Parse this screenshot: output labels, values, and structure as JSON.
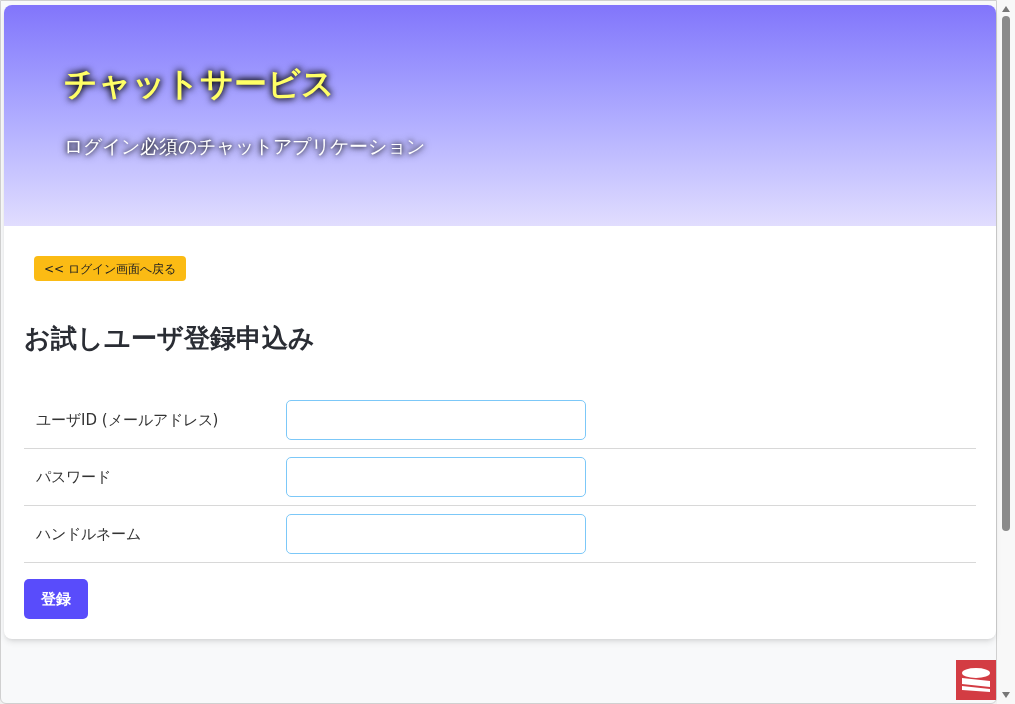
{
  "header": {
    "title": "チャットサービス",
    "subtitle": "ログイン必須のチャットアプリケーション"
  },
  "back_button": "<< ログイン画面へ戻る",
  "heading": "お試しユーザ登録申込み",
  "fields": [
    {
      "label": "ユーザID (メールアドレス)"
    },
    {
      "label": "パスワード"
    },
    {
      "label": "ハンドルネーム"
    }
  ],
  "submit_button": "登録"
}
